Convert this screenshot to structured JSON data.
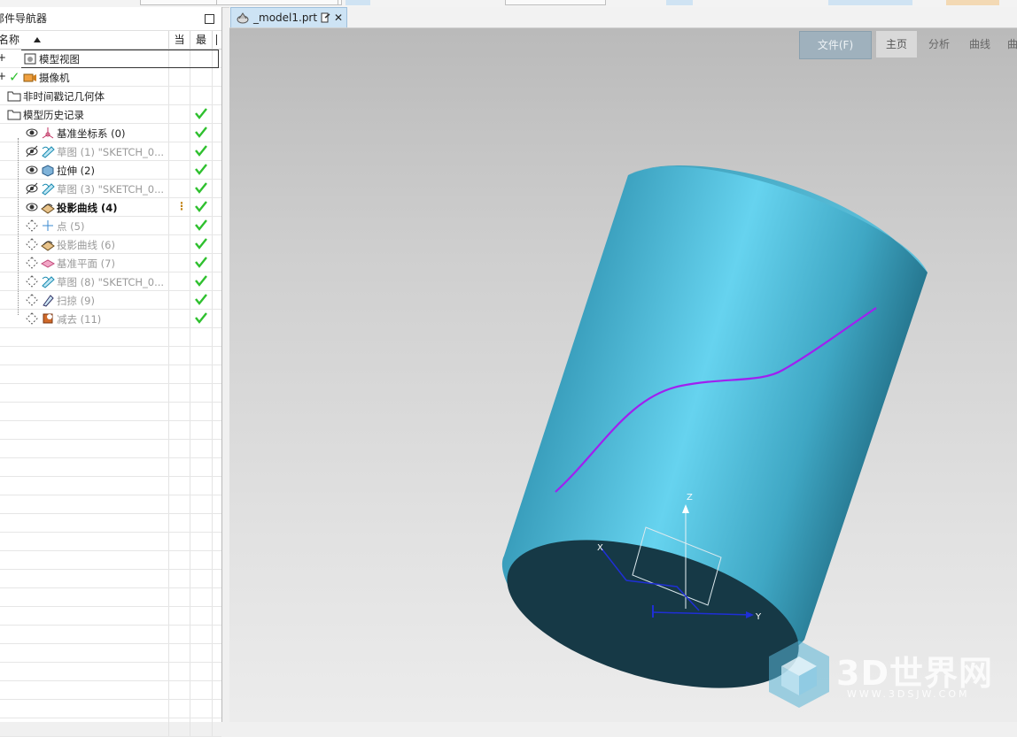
{
  "navigator": {
    "title": "部件导航器",
    "columns": {
      "name": "名称",
      "current": "当",
      "latest": "最"
    },
    "items": [
      {
        "label": "模型视图",
        "style": "normal",
        "check": false
      },
      {
        "label": "摄像机",
        "style": "normal",
        "check": false
      },
      {
        "label": "非时间戳记几何体",
        "style": "normal",
        "check": false
      },
      {
        "label": "模型历史记录",
        "style": "normal",
        "check": true
      },
      {
        "label": "基准坐标系 (0)",
        "style": "normal",
        "check": true
      },
      {
        "label": "草图 (1) \"SKETCH_0...",
        "style": "dim",
        "check": true
      },
      {
        "label": "拉伸 (2)",
        "style": "normal",
        "check": true
      },
      {
        "label": "草图 (3) \"SKETCH_0...",
        "style": "dim",
        "check": true
      },
      {
        "label": "投影曲线 (4)",
        "style": "bold",
        "check": true
      },
      {
        "label": "点 (5)",
        "style": "dim",
        "check": true
      },
      {
        "label": "投影曲线 (6)",
        "style": "dim",
        "check": true
      },
      {
        "label": "基准平面 (7)",
        "style": "dim",
        "check": true
      },
      {
        "label": "草图 (8) \"SKETCH_0...",
        "style": "dim",
        "check": true
      },
      {
        "label": "扫掠 (9)",
        "style": "dim",
        "check": true
      },
      {
        "label": "减去 (11)",
        "style": "dim",
        "check": true
      }
    ]
  },
  "document": {
    "tab_label": "_model1.prt"
  },
  "ribbon": {
    "file": "文件(F)",
    "home": "主页",
    "analysis": "分析",
    "curve": "曲线",
    "more": "曲"
  },
  "axes": {
    "z": "Z",
    "y": "Y",
    "x": "X"
  },
  "watermark": {
    "brand": "3D世界网",
    "url": "WWW.3DSJW.COM"
  },
  "colors": {
    "cylinder": "#4fb7d4",
    "cylinder_dark": "#163946",
    "curve": "#a020f0",
    "check": "#2ec02e"
  }
}
